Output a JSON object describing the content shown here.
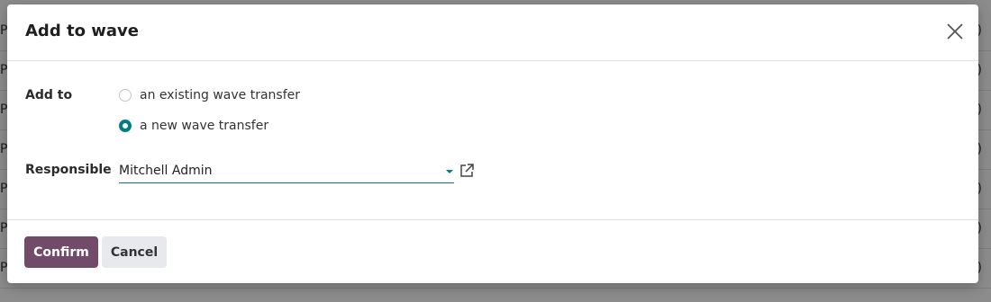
{
  "background": {
    "rows": [
      {
        "left": "Pa",
        "right": ")"
      },
      {
        "left": "Pa",
        "right": ")"
      },
      {
        "left": "Pa",
        "right": ")"
      },
      {
        "left": "Pa",
        "right": ")"
      },
      {
        "left": "Pa",
        "right": ")"
      },
      {
        "left": "Pa",
        "right": ")"
      },
      {
        "left": "Pa",
        "right": ")"
      }
    ]
  },
  "dialog": {
    "title": "Add to wave",
    "add_to_label": "Add to",
    "options": [
      {
        "label": "an existing wave transfer",
        "checked": false
      },
      {
        "label": "a new wave transfer",
        "checked": true
      }
    ],
    "responsible_label": "Responsible",
    "responsible_value": "Mitchell Admin",
    "confirm_label": "Confirm",
    "cancel_label": "Cancel"
  },
  "colors": {
    "primary": "#714b67",
    "accent": "#017e84"
  }
}
